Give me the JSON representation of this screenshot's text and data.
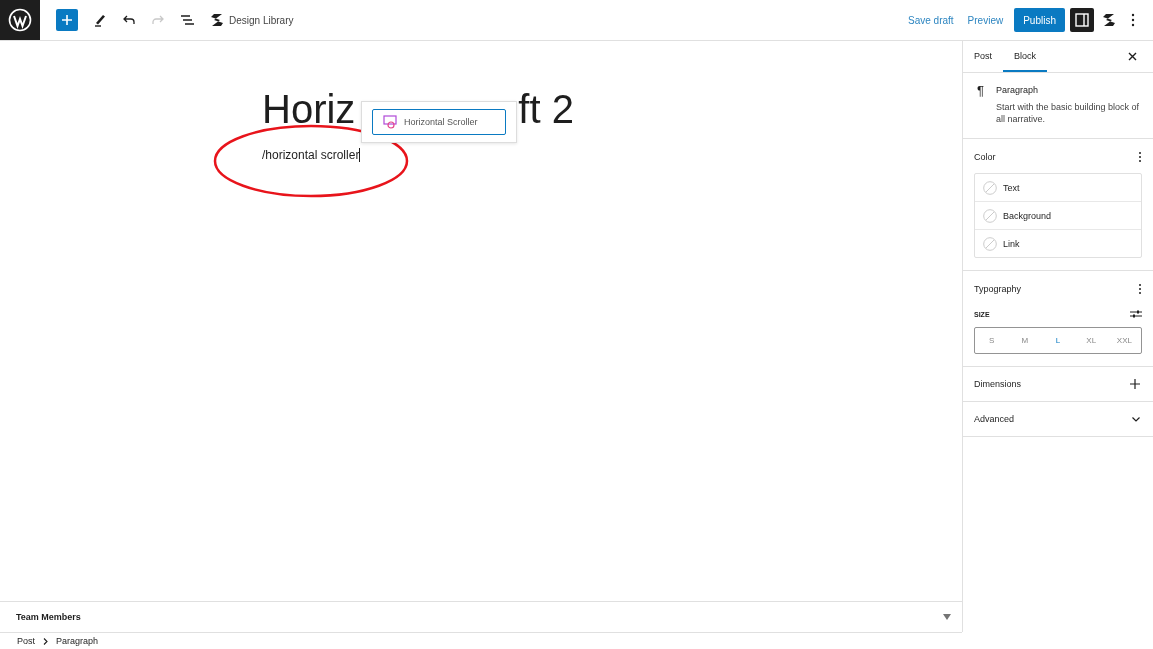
{
  "toolbar": {
    "library": "Design Library",
    "save_draft": "Save draft",
    "preview": "Preview",
    "publish": "Publish",
    "settings_on": true
  },
  "editor": {
    "title_parts": [
      "Horiz",
      "ft 2"
    ],
    "paragraph": "/horizontal scroller",
    "suggestion": {
      "label": "Horizontal Scroller",
      "selected": true
    }
  },
  "sidebar": {
    "tabs": [
      {
        "label": "Post",
        "selected": false
      },
      {
        "label": "Block",
        "selected": true
      }
    ],
    "block": {
      "icon": "¶",
      "name": "Paragraph",
      "description": "Start with the basic building block of all narrative."
    },
    "color": {
      "title": "Color",
      "items": [
        "Text",
        "Background",
        "Link"
      ]
    },
    "typography": {
      "title": "Typography",
      "size_label": "SIZE",
      "sizes": [
        {
          "label": "S",
          "selected": false
        },
        {
          "label": "M",
          "selected": false
        },
        {
          "label": "L",
          "selected": true
        },
        {
          "label": "XL",
          "selected": false
        },
        {
          "label": "XXL",
          "selected": false
        }
      ]
    },
    "panels": [
      {
        "label": "Dimensions",
        "kind": "plus"
      },
      {
        "label": "Advanced",
        "kind": "chevron"
      }
    ]
  },
  "meta_box": {
    "label": "Team Members"
  },
  "breadcrumb": [
    "Post",
    "Paragraph"
  ]
}
